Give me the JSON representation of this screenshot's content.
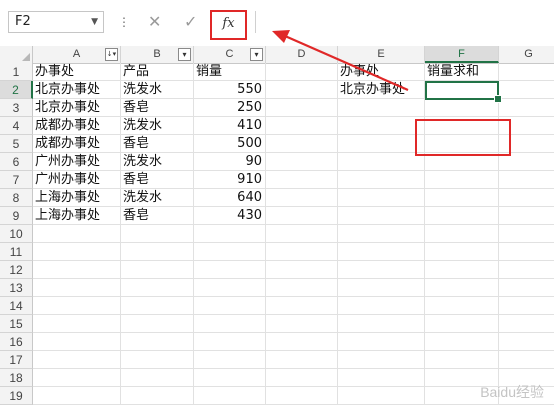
{
  "formula_bar": {
    "name_box": "F2",
    "cancel_glyph": "✕",
    "enter_glyph": "✓",
    "fx_label": "fx",
    "formula_value": ""
  },
  "columns": [
    "A",
    "B",
    "C",
    "D",
    "E",
    "F",
    "G"
  ],
  "selected_column": "F",
  "selected_row": 2,
  "rows": [
    1,
    2,
    3,
    4,
    5,
    6,
    7,
    8,
    9,
    10,
    11,
    12,
    13,
    14,
    15,
    16,
    17,
    18,
    19
  ],
  "table": {
    "headers": [
      "办事处",
      "产品",
      "销量"
    ],
    "records": [
      [
        "北京办事处",
        "洗发水",
        "550"
      ],
      [
        "北京办事处",
        "香皂",
        "250"
      ],
      [
        "成都办事处",
        "洗发水",
        "410"
      ],
      [
        "成都办事处",
        "香皂",
        "500"
      ],
      [
        "广州办事处",
        "洗发水",
        "90"
      ],
      [
        "广州办事处",
        "香皂",
        "910"
      ],
      [
        "上海办事处",
        "洗发水",
        "640"
      ],
      [
        "上海办事处",
        "香皂",
        "430"
      ]
    ]
  },
  "side": {
    "e1": "办事处",
    "f1": "销量求和",
    "e2": "北京办事处",
    "f2": ""
  },
  "watermark": "Baidu经验",
  "colors": {
    "accent_green": "#217346",
    "annotation_red": "#e02828"
  }
}
